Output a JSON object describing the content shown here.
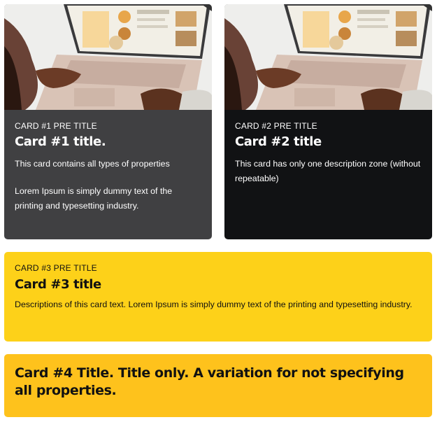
{
  "cards": [
    {
      "pre_title": "CARD #1 PRE TITLE",
      "title": "Card #1 title.",
      "descriptions": [
        "This card contains all types of properties",
        "Lorem Ipsum is simply dummy text of the printing and typesetting industry."
      ],
      "image": "laptop-photo",
      "background": "#404042"
    },
    {
      "pre_title": "CARD #2 PRE TITLE",
      "title": "Card #2 title",
      "descriptions": [
        "This card has only one description zone (without repeatable)"
      ],
      "image": "laptop-photo",
      "background": "#111214"
    },
    {
      "pre_title": "CARD #3 PRE TITLE",
      "title": "Card #3 title",
      "descriptions": [
        "Descriptions of this card text. Lorem Ipsum is simply dummy text of the printing and typesetting industry."
      ],
      "background": "#fdd119"
    },
    {
      "title": "Card #4 Title. Title only. A variation for not specifying all properties.",
      "background": "#fec21c"
    }
  ]
}
